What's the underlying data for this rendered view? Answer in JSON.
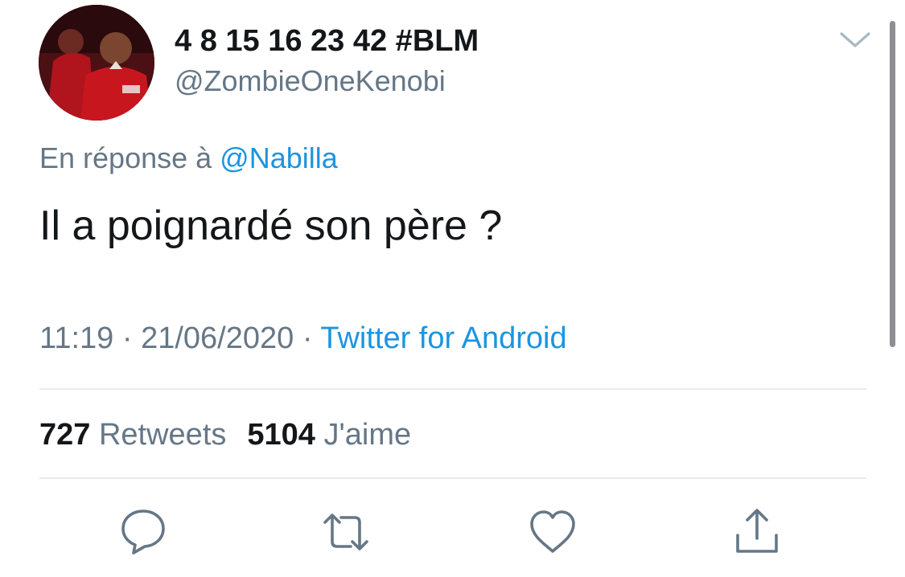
{
  "author": {
    "display_name": "4 8 15 16 23 42 #BLM",
    "handle": "@ZombieOneKenobi",
    "avatar": "avatar-image"
  },
  "reply": {
    "prefix": "En réponse à",
    "mention": "@Nabilla"
  },
  "tweet": {
    "text": "Il a poignardé son père ?"
  },
  "meta": {
    "time": "11:19",
    "separator": "·",
    "date": "21/06/2020",
    "source": "Twitter for Android"
  },
  "stats": {
    "retweets_count": "727",
    "retweets_label": "Retweets",
    "likes_count": "5104",
    "likes_label": "J'aime"
  },
  "actions": {
    "reply_icon": "comment-bubble-icon",
    "retweet_icon": "retweet-icon",
    "like_icon": "heart-icon",
    "share_icon": "share-icon"
  },
  "colors": {
    "text": "#14171a",
    "secondary": "#657786",
    "link": "#1b95e0",
    "divider": "#e6ecf0"
  }
}
